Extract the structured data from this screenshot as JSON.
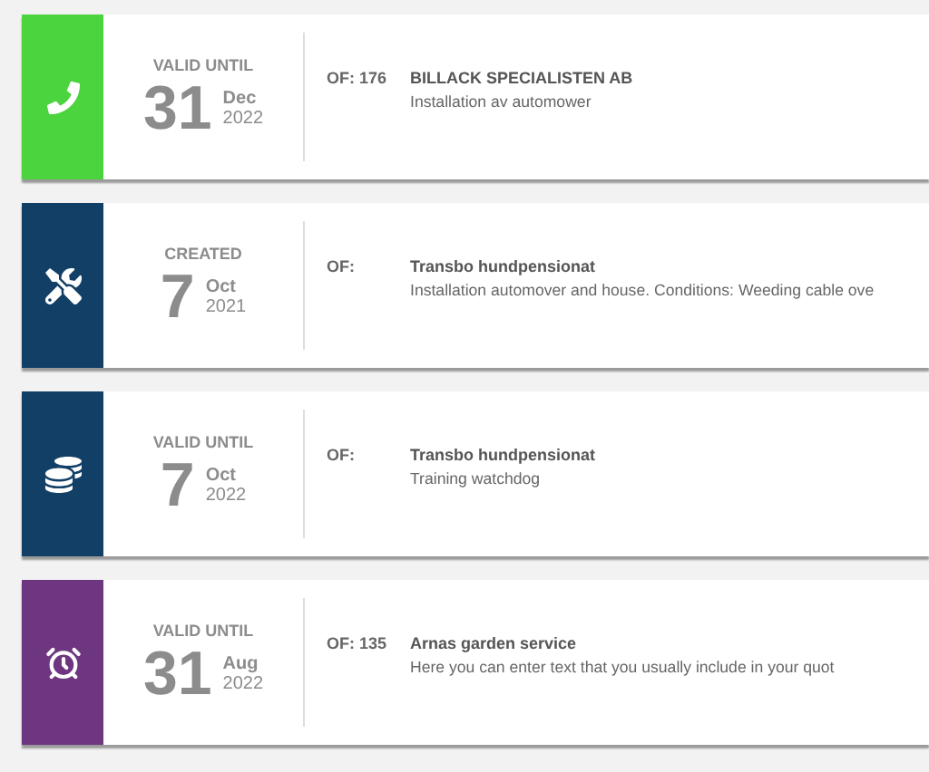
{
  "cards": [
    {
      "kind": "call",
      "color": "#4cd43f",
      "date_label": "VALID UNTIL",
      "day": "31",
      "month": "Dec",
      "year": "2022",
      "of_label": "OF: 176",
      "customer": "BILLACK SPECIALISTEN AB",
      "description": "Installation av automower"
    },
    {
      "kind": "tools",
      "color": "#123f66",
      "date_label": "CREATED",
      "day": "7",
      "month": "Oct",
      "year": "2021",
      "of_label": "OF:",
      "customer": "Transbo hundpensionat",
      "description": "Installation automover and house. Conditions: Weeding cable ove"
    },
    {
      "kind": "coins",
      "color": "#123f66",
      "date_label": "VALID UNTIL",
      "day": "7",
      "month": "Oct",
      "year": "2022",
      "of_label": "OF:",
      "customer": "Transbo hundpensionat",
      "description": "Training watchdog"
    },
    {
      "kind": "alarm",
      "color": "#6e3580",
      "date_label": "VALID UNTIL",
      "day": "31",
      "month": "Aug",
      "year": "2022",
      "of_label": "OF: 135",
      "customer": "Arnas garden service",
      "description": "Here you can enter text that you usually include in your quot"
    }
  ]
}
